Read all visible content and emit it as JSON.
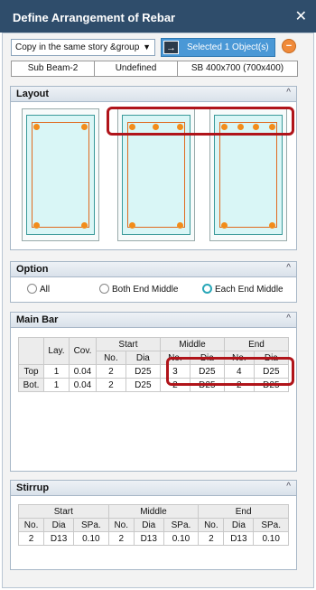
{
  "window": {
    "title": "Define Arrangement of Rebar",
    "close_glyph": "✕"
  },
  "toolbar": {
    "select_value": "Copy in the same story &group",
    "selected_label": "Selected 1 Object(s)",
    "arrow_icon": "→",
    "remove_icon": "−"
  },
  "tabs": [
    "Sub Beam-2",
    "Undefined",
    "SB 400x700 (700x400)"
  ],
  "layout": {
    "title": "Layout",
    "chevron": "^"
  },
  "option": {
    "title": "Option",
    "chevron": "^",
    "choices": [
      "All",
      "Both End Middle",
      "Each End Middle"
    ],
    "selected": "Each End Middle"
  },
  "main_bar": {
    "title": "Main Bar",
    "chevron": "^",
    "headers": {
      "lay": "Lay.",
      "cov": "Cov.",
      "start": "Start",
      "middle": "Middle",
      "end": "End",
      "no": "No.",
      "dia": "Dia"
    },
    "rows": [
      {
        "label": "Top",
        "lay": "1",
        "cov": "0.04",
        "start_no": "2",
        "start_dia": "D25",
        "mid_no": "3",
        "mid_dia": "D25",
        "end_no": "4",
        "end_dia": "D25"
      },
      {
        "label": "Bot.",
        "lay": "1",
        "cov": "0.04",
        "start_no": "2",
        "start_dia": "D25",
        "mid_no": "2",
        "mid_dia": "D25",
        "end_no": "2",
        "end_dia": "D25"
      }
    ]
  },
  "stirrup": {
    "title": "Stirrup",
    "chevron": "^",
    "headers": {
      "start": "Start",
      "middle": "Middle",
      "end": "End",
      "no": "No.",
      "dia": "Dia",
      "spa": "SPa."
    },
    "row": {
      "start_no": "2",
      "start_dia": "D13",
      "start_spa": "0.10",
      "mid_no": "2",
      "mid_dia": "D13",
      "mid_spa": "0.10",
      "end_no": "2",
      "end_dia": "D13",
      "end_spa": "0.10"
    }
  }
}
